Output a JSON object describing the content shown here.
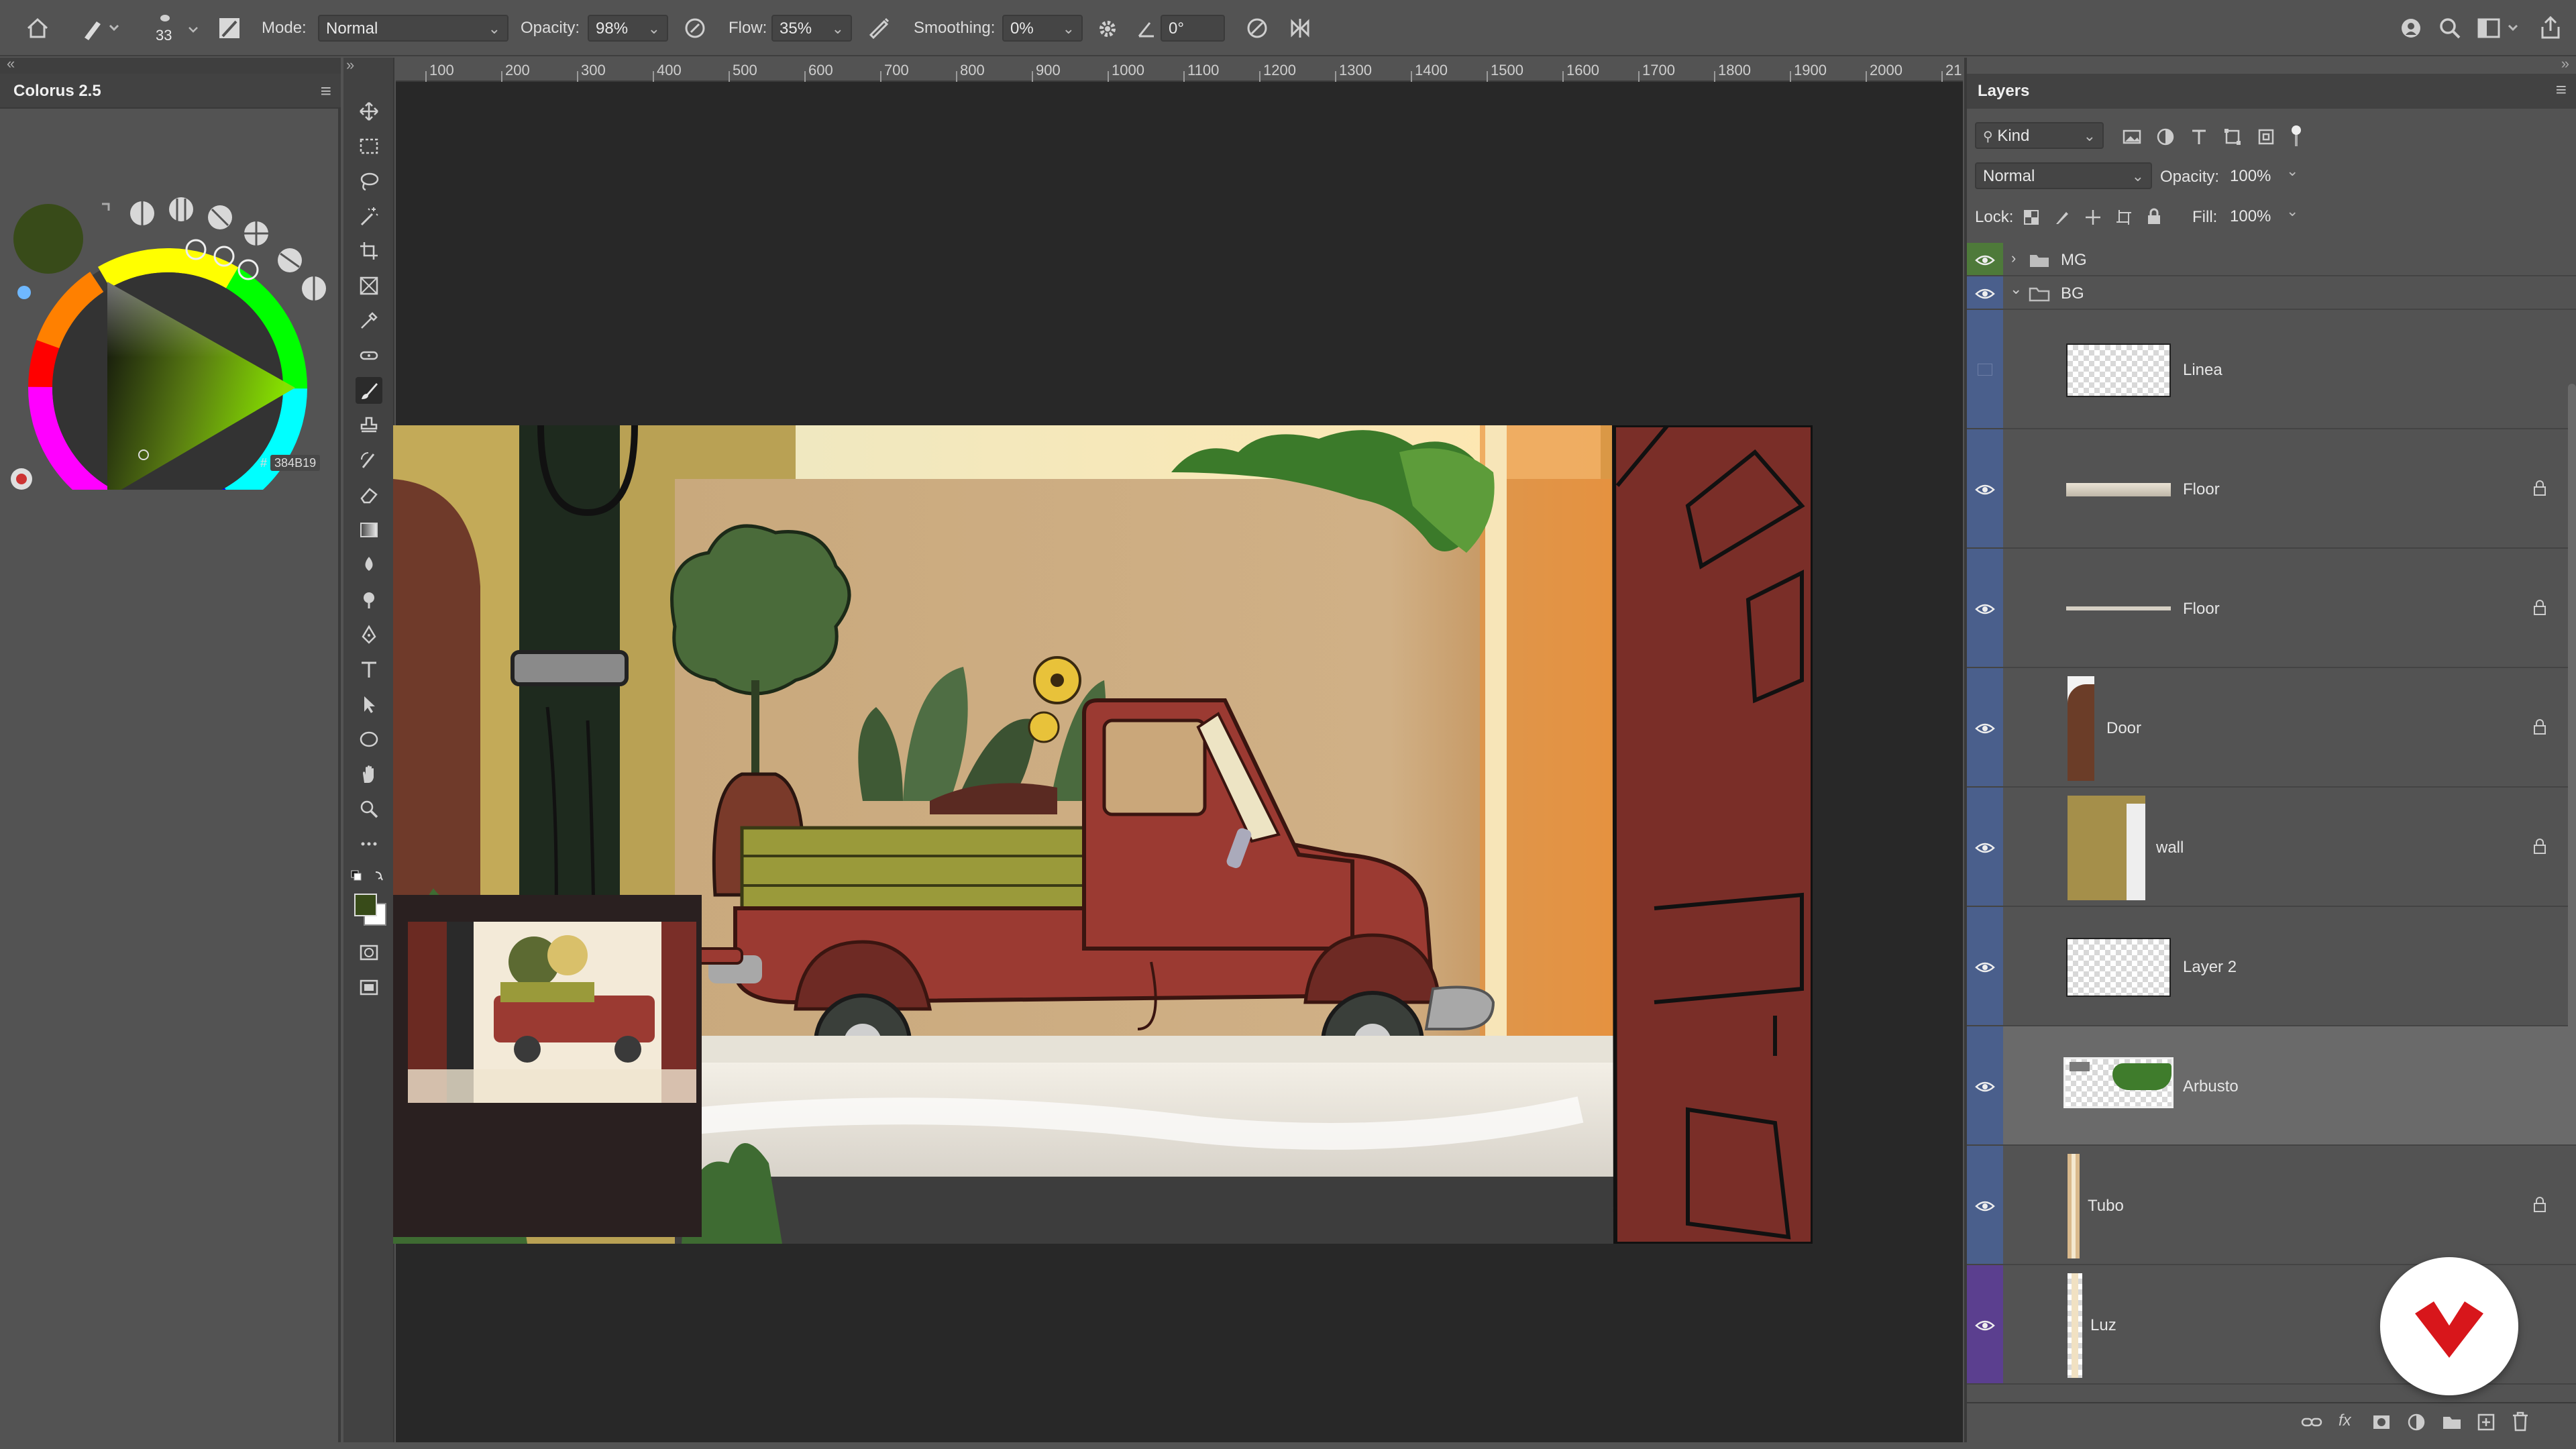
{
  "options_bar": {
    "brush_size": "33",
    "mode_label": "Mode:",
    "mode_value": "Normal",
    "opacity_label": "Opacity:",
    "opacity_value": "98%",
    "flow_label": "Flow:",
    "flow_value": "35%",
    "smoothing_label": "Smoothing:",
    "smoothing_value": "0%",
    "angle_value": "0°"
  },
  "colourus": {
    "title": "Colorus 2.5",
    "hex_prefix": "#",
    "hex_value": "384B19",
    "current_color": "#384b19"
  },
  "ruler": {
    "ticks": [
      "100",
      "200",
      "300",
      "400",
      "500",
      "600",
      "700",
      "800",
      "900",
      "1000",
      "1100",
      "1200",
      "1300",
      "1400",
      "1500",
      "1600",
      "1700",
      "1800",
      "1900",
      "2000",
      "21"
    ]
  },
  "layers_panel": {
    "title": "Layers",
    "filter_value": "Kind",
    "blend_mode": "Normal",
    "opacity_label": "Opacity:",
    "opacity_value": "100%",
    "lock_label": "Lock:",
    "fill_label": "Fill:",
    "fill_value": "100%",
    "groups": [
      {
        "name": "MG",
        "color": "#4e7a3a"
      },
      {
        "name": "BG",
        "color": "#4a5f8c"
      }
    ],
    "layers": [
      {
        "name": "Linea",
        "visible": false,
        "locked": false
      },
      {
        "name": "Floor",
        "visible": true,
        "locked": true
      },
      {
        "name": "Floor",
        "visible": true,
        "locked": true
      },
      {
        "name": "Door",
        "visible": true,
        "locked": true
      },
      {
        "name": "wall",
        "visible": true,
        "locked": true
      },
      {
        "name": "Layer 2",
        "visible": true,
        "locked": false
      },
      {
        "name": "Arbusto",
        "visible": true,
        "locked": false,
        "selected": true
      },
      {
        "name": "Tubo",
        "visible": true,
        "locked": true
      },
      {
        "name": "Luz",
        "visible": true,
        "locked": false
      }
    ]
  },
  "colors": {
    "accent_blue": "#4a5f8c",
    "accent_purple": "#5b3f8f",
    "accent_green": "#4e7a3a",
    "brand_red": "#d8161b"
  }
}
